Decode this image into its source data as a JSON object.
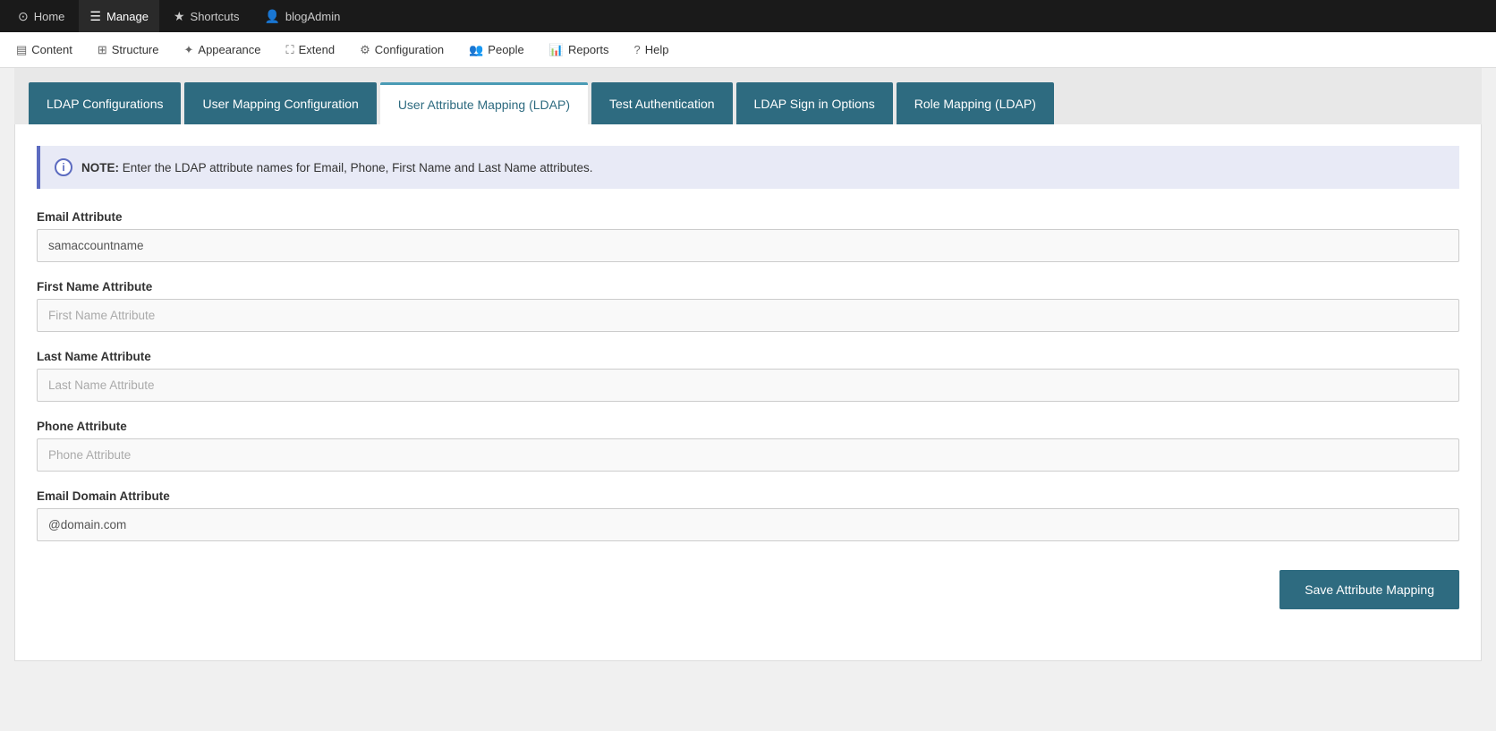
{
  "topNav": {
    "items": [
      {
        "id": "home",
        "label": "Home",
        "icon": "⊙"
      },
      {
        "id": "manage",
        "label": "Manage",
        "icon": "☰"
      },
      {
        "id": "shortcuts",
        "label": "Shortcuts",
        "icon": "★"
      },
      {
        "id": "blogAdmin",
        "label": "blogAdmin",
        "icon": "👤"
      }
    ]
  },
  "adminMenu": {
    "items": [
      {
        "id": "content",
        "label": "Content",
        "icon": "▤"
      },
      {
        "id": "structure",
        "label": "Structure",
        "icon": "⊞"
      },
      {
        "id": "appearance",
        "label": "Appearance",
        "icon": "✦"
      },
      {
        "id": "extend",
        "label": "Extend",
        "icon": "⛶"
      },
      {
        "id": "configuration",
        "label": "Configuration",
        "icon": "⚙"
      },
      {
        "id": "people",
        "label": "People",
        "icon": "👥"
      },
      {
        "id": "reports",
        "label": "Reports",
        "icon": "📊"
      },
      {
        "id": "help",
        "label": "Help",
        "icon": "?"
      }
    ]
  },
  "tabs": [
    {
      "id": "ldap-configurations",
      "label": "LDAP Configurations",
      "active": false
    },
    {
      "id": "user-mapping-configuration",
      "label": "User Mapping Configuration",
      "active": false
    },
    {
      "id": "user-attribute-mapping",
      "label": "User Attribute Mapping (LDAP)",
      "active": true
    },
    {
      "id": "test-authentication",
      "label": "Test Authentication",
      "active": false
    },
    {
      "id": "ldap-sign-in-options",
      "label": "LDAP Sign in Options",
      "active": false
    },
    {
      "id": "role-mapping",
      "label": "Role Mapping (LDAP)",
      "active": false
    }
  ],
  "note": {
    "prefix": "NOTE:",
    "text": " Enter the LDAP attribute names for Email, Phone, First Name and Last Name attributes."
  },
  "fields": [
    {
      "id": "email-attribute",
      "label": "Email Attribute",
      "value": "samaccountname",
      "placeholder": ""
    },
    {
      "id": "first-name-attribute",
      "label": "First Name Attribute",
      "value": "",
      "placeholder": "First Name Attribute"
    },
    {
      "id": "last-name-attribute",
      "label": "Last Name Attribute",
      "value": "",
      "placeholder": "Last Name Attribute"
    },
    {
      "id": "phone-attribute",
      "label": "Phone Attribute",
      "value": "",
      "placeholder": "Phone Attribute"
    },
    {
      "id": "email-domain-attribute",
      "label": "Email Domain Attribute",
      "value": "@domain.com",
      "placeholder": ""
    }
  ],
  "saveButton": {
    "label": "Save Attribute Mapping"
  }
}
